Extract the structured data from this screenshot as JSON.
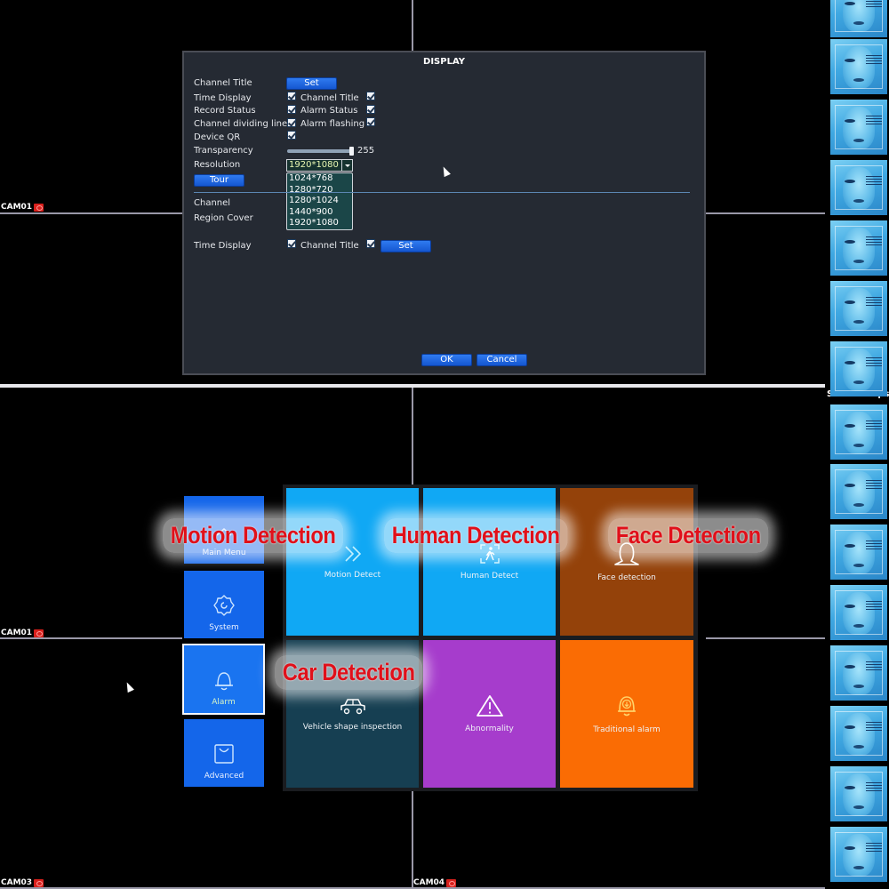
{
  "cameras": {
    "top_left": "CAM01",
    "bottom_left_upper": "CAM01",
    "bottom_left_lower": "CAM03",
    "bottom_right_lower": "CAM04"
  },
  "display_dialog": {
    "title": "DISPLAY",
    "rows": {
      "channel_title": "Channel Title",
      "set_label": "Set",
      "time_display": "Time Display",
      "channel_title_2": "Channel Title",
      "record_status": "Record Status",
      "alarm_status": "Alarm Status",
      "channel_dividing_line": "Channel dividing line",
      "alarm_flashing": "Alarm flashing",
      "device_qr": "Device QR",
      "transparency": "Transparency",
      "transparency_value": "255",
      "resolution": "Resolution",
      "resolution_value": "1920*1080",
      "tour": "Tour",
      "channel": "Channel",
      "region_cover": "Region Cover",
      "time_display_2": "Time Display",
      "channel_title_3": "Channel Title",
      "set_label_2": "Set"
    },
    "checkboxes": {
      "time_display": true,
      "channel_title": true,
      "record_status": true,
      "alarm_status": true,
      "channel_dividing_line": true,
      "alarm_flashing": true,
      "device_qr": true,
      "time_display_2": true,
      "channel_title_3": true
    },
    "transparency_fraction": 1.0,
    "resolution_options": [
      "1024*768",
      "1280*720",
      "1280*1024",
      "1440*900",
      "1920*1080"
    ],
    "ok_label": "OK",
    "cancel_label": "Cancel"
  },
  "snapshot_strip": {
    "title": "Smart snapshot"
  },
  "side_menu": [
    {
      "label": "Main Menu",
      "icon": "home-icon"
    },
    {
      "label": "System",
      "icon": "gear-icon"
    },
    {
      "label": "Alarm",
      "icon": "bell-icon",
      "active": true
    },
    {
      "label": "Advanced",
      "icon": "bag-icon"
    }
  ],
  "alarm_tiles": [
    {
      "label": "Motion Detect",
      "icon": "double-chevron-icon",
      "color": "#10a8f4"
    },
    {
      "label": "Human Detect",
      "icon": "human-detect-icon",
      "color": "#10a8f4"
    },
    {
      "label": "Face detection",
      "icon": "face-icon",
      "color": "#94420a"
    },
    {
      "label": "Vehicle shape inspection",
      "icon": "car-icon",
      "color": "#163f52"
    },
    {
      "label": "Abnormality",
      "icon": "warning-icon",
      "color": "#a63ccc"
    },
    {
      "label": "Traditional alarm",
      "icon": "alarm-bell-icon",
      "color": "#fa6c04"
    }
  ],
  "overlays": {
    "motion": "Motion Detection",
    "human": "Human Detection",
    "face": "Face Detection",
    "car": "Car Detection"
  }
}
